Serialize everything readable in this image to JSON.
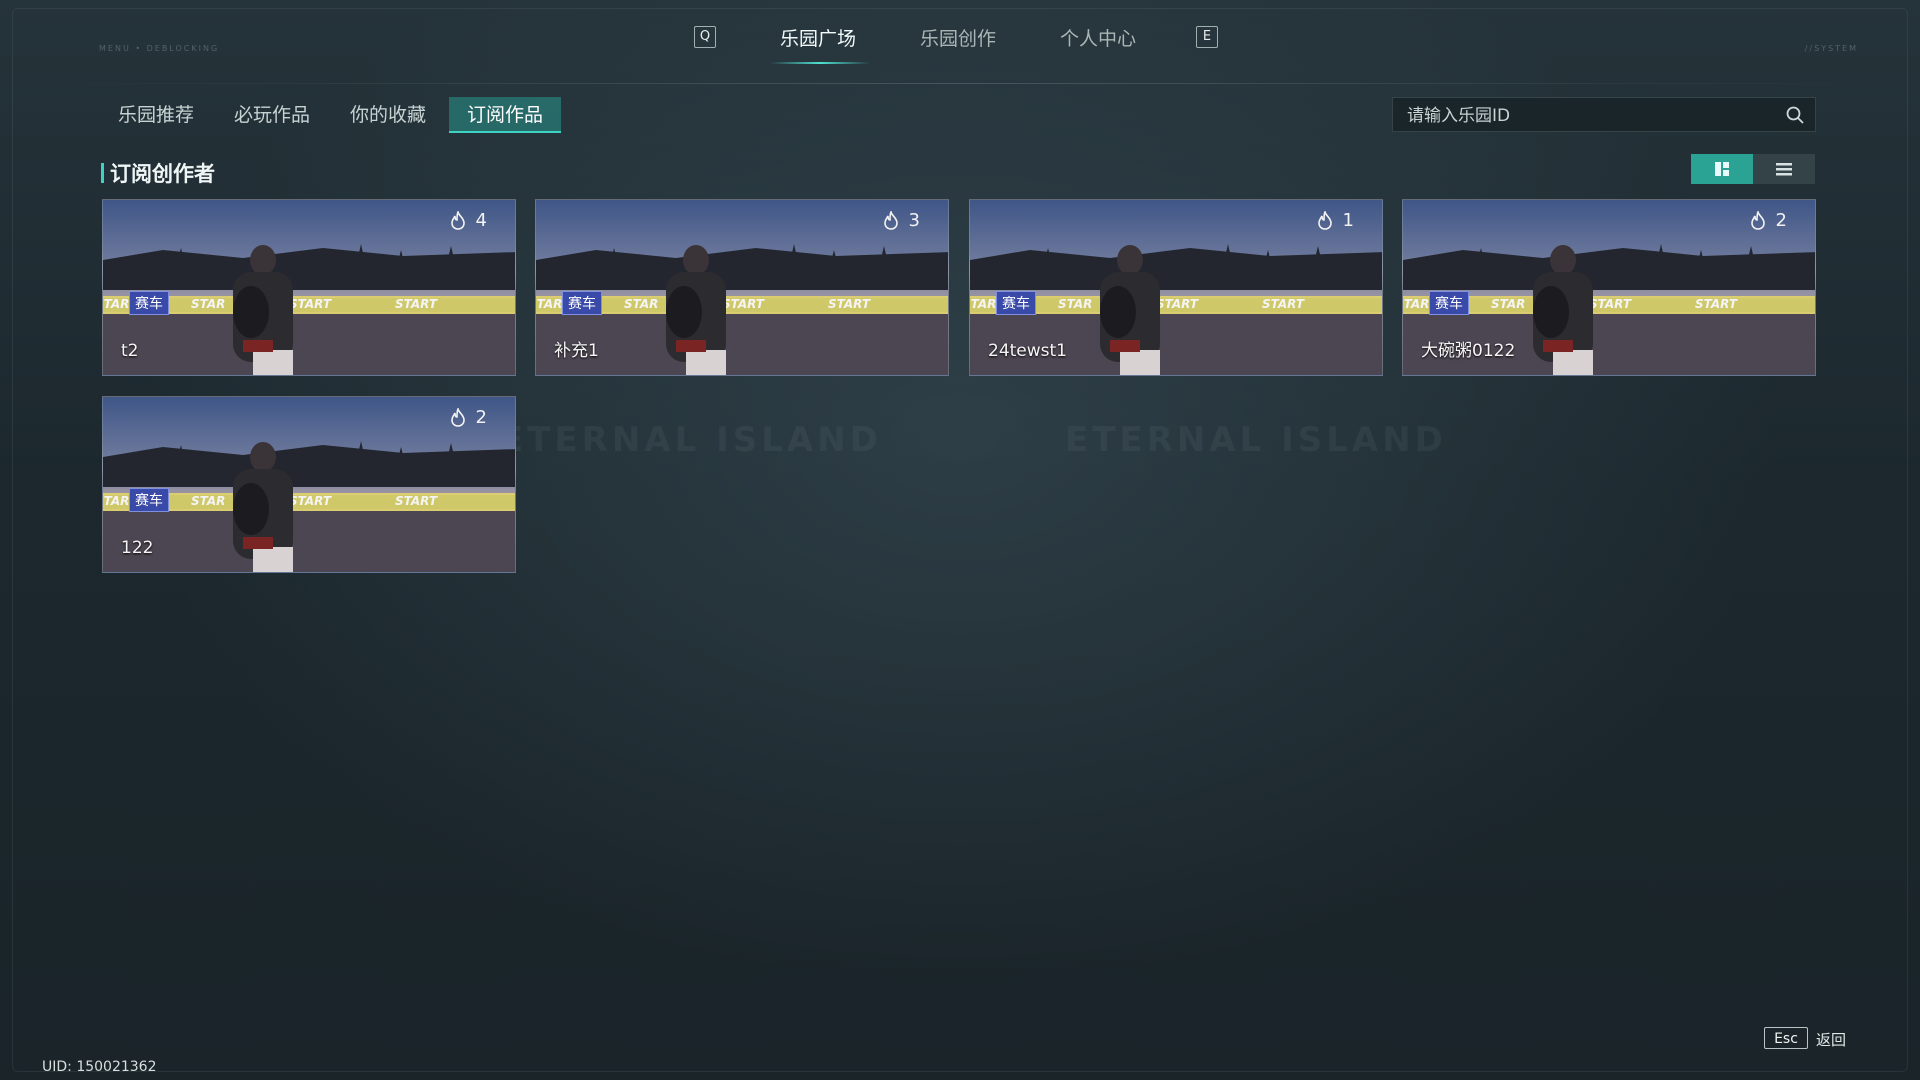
{
  "top_nav": {
    "left_key": "Q",
    "right_key": "E",
    "tabs": [
      "乐园广场",
      "乐园创作",
      "个人中心"
    ],
    "active_tab": "乐园广场"
  },
  "sub_tabs": [
    "乐园推荐",
    "必玩作品",
    "你的收藏",
    "订阅作品"
  ],
  "active_sub_tab": "订阅作品",
  "search": {
    "placeholder": "请输入乐园ID"
  },
  "section": {
    "title": "订阅创作者"
  },
  "cards": [
    {
      "name": "t2",
      "heat": "4",
      "tag": "赛车"
    },
    {
      "name": "补充1",
      "heat": "3",
      "tag": "赛车"
    },
    {
      "name": "24tewst1",
      "heat": "1",
      "tag": "赛车"
    },
    {
      "name": "大碗粥0122",
      "heat": "2",
      "tag": "赛车"
    },
    {
      "name": "122",
      "heat": "2",
      "tag": "赛车"
    }
  ],
  "footer": {
    "uid": "UID: 150021362",
    "esc_key": "Esc",
    "back_label": "返回"
  },
  "decor": {
    "corner_left": "MENU • DEBLOCKING",
    "corner_right": "//SYSTEM",
    "watermark": "ETERNAL ISLAND"
  },
  "colors": {
    "accent": "#3fd1c1",
    "active_tab_bg": "#2aa394",
    "tag_bg": "#3a4aa8"
  }
}
